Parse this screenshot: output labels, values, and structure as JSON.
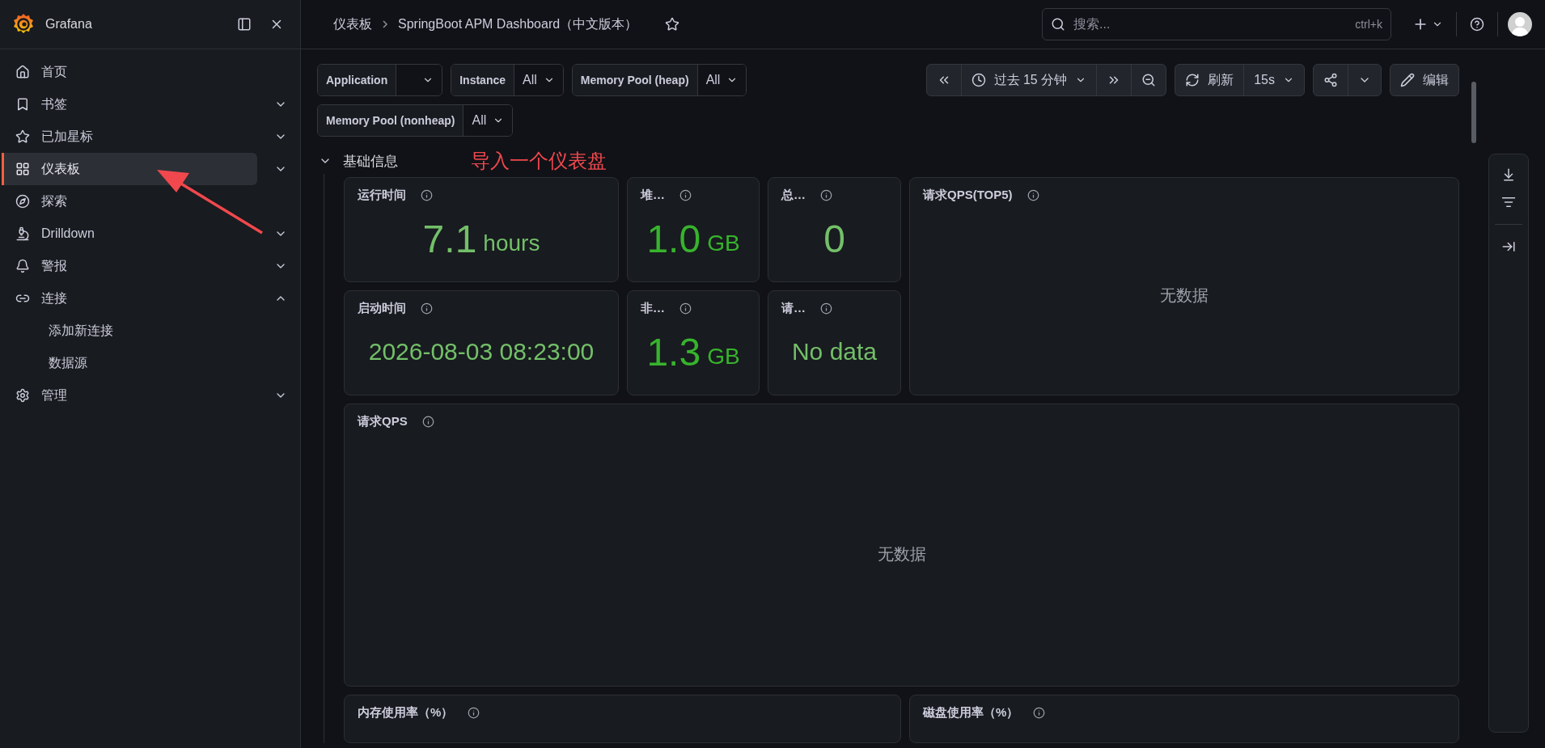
{
  "sidebar": {
    "brand": "Grafana",
    "items": [
      {
        "label": "首页"
      },
      {
        "label": "书签",
        "expanded": false
      },
      {
        "label": "已加星标",
        "expanded": false
      },
      {
        "label": "仪表板",
        "expanded": false,
        "selected": true
      },
      {
        "label": "探索"
      },
      {
        "label": "Drilldown",
        "expanded": false
      },
      {
        "label": "警报",
        "expanded": false
      },
      {
        "label": "连接",
        "expanded": true,
        "children": [
          {
            "label": "添加新连接"
          },
          {
            "label": "数据源"
          }
        ]
      },
      {
        "label": "管理",
        "expanded": false
      }
    ]
  },
  "topbar": {
    "breadcrumbs": [
      "仪表板",
      "SpringBoot APM Dashboard（中文版本）"
    ],
    "search": {
      "placeholder": "搜索...",
      "shortcut": "ctrl+k"
    }
  },
  "variables": [
    {
      "label": "Application"
    },
    {
      "label": "Instance",
      "value": "All"
    },
    {
      "label": "Memory Pool (heap)",
      "value": "All"
    },
    {
      "label": "Memory Pool (nonheap)",
      "value": "All"
    }
  ],
  "controls": {
    "time_range": "过去 15 分钟",
    "refresh": "刷新",
    "interval": "15s",
    "edit": "编辑"
  },
  "row": {
    "title": "基础信息",
    "expanded": true
  },
  "annotation": "导入一个仪表盘",
  "panels": [
    {
      "kind": "stat",
      "title": "运行时间",
      "value": "7.1",
      "unit": "hours",
      "color": "#73bf69"
    },
    {
      "kind": "stat",
      "title": "堆…",
      "value": "1.0",
      "unit": "GB",
      "color": "#37b32d"
    },
    {
      "kind": "stat",
      "title": "总…",
      "value": "0",
      "color": "#73bf69"
    },
    {
      "kind": "graph",
      "title": "请求QPS(TOP5)",
      "message": "无数据"
    },
    {
      "kind": "stat",
      "title": "启动时间",
      "value": "2026-08-03 08:23:00",
      "color": "#73bf69"
    },
    {
      "kind": "stat",
      "title": "非…",
      "value": "1.3",
      "unit": "GB",
      "color": "#37b32d"
    },
    {
      "kind": "stat",
      "title": "请…",
      "value": "No data",
      "color": "#73bf69"
    },
    {
      "kind": "graph",
      "title": "请求QPS",
      "message": "无数据"
    },
    {
      "kind": "graph",
      "title": "内存使用率（%）"
    },
    {
      "kind": "graph",
      "title": "磁盘使用率（%）"
    }
  ]
}
